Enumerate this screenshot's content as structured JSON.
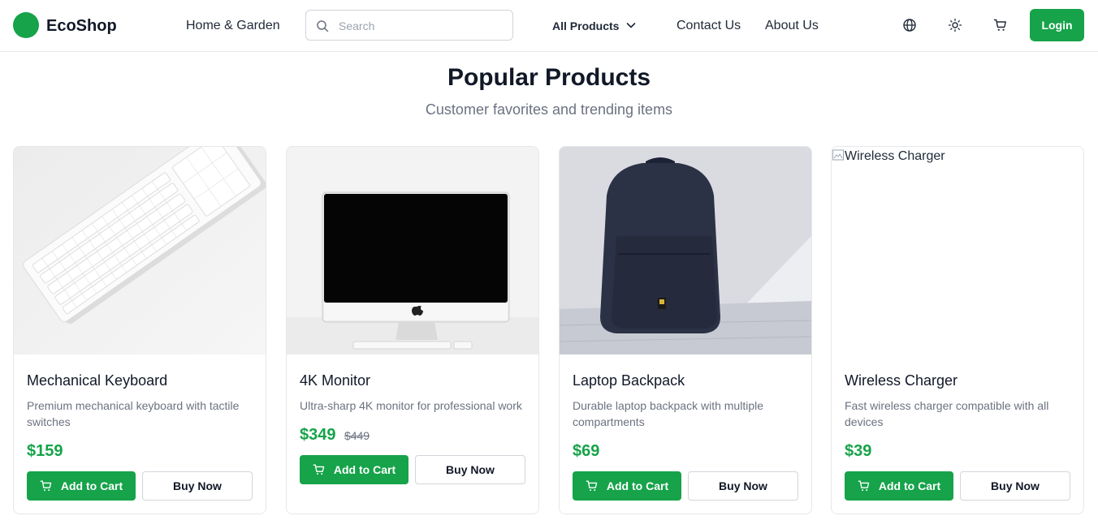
{
  "header": {
    "brand": "EcoShop",
    "brand_color": "#16a34a",
    "nav_category": "Home & Garden",
    "search_placeholder": "Search",
    "all_products_label": "All Products",
    "contact_label": "Contact Us",
    "about_label": "About Us",
    "icons": [
      "globe-icon",
      "sun-icon",
      "cart-icon"
    ],
    "login_label": "Login"
  },
  "section": {
    "title": "Popular Products",
    "subtitle": "Customer favorites and trending items"
  },
  "products": [
    {
      "name": "Mechanical Keyboard",
      "description": "Premium mechanical keyboard with tactile switches",
      "price": "$159",
      "old_price": "",
      "add_to_cart_label": "Add to Cart",
      "buy_now_label": "Buy Now",
      "image": "keyboard-image"
    },
    {
      "name": "4K Monitor",
      "description": "Ultra-sharp 4K monitor for professional work",
      "price": "$349",
      "old_price": "$449",
      "add_to_cart_label": "Add to Cart",
      "buy_now_label": "Buy Now",
      "image": "monitor-image"
    },
    {
      "name": "Laptop Backpack",
      "description": "Durable laptop backpack with multiple compartments",
      "price": "$69",
      "old_price": "",
      "add_to_cart_label": "Add to Cart",
      "buy_now_label": "Buy Now",
      "image": "backpack-image"
    },
    {
      "name": "Wireless Charger",
      "description": "Fast wireless charger compatible with all devices",
      "price": "$39",
      "old_price": "",
      "add_to_cart_label": "Add to Cart",
      "buy_now_label": "Buy Now",
      "image_alt": "Wireless Charger"
    }
  ]
}
